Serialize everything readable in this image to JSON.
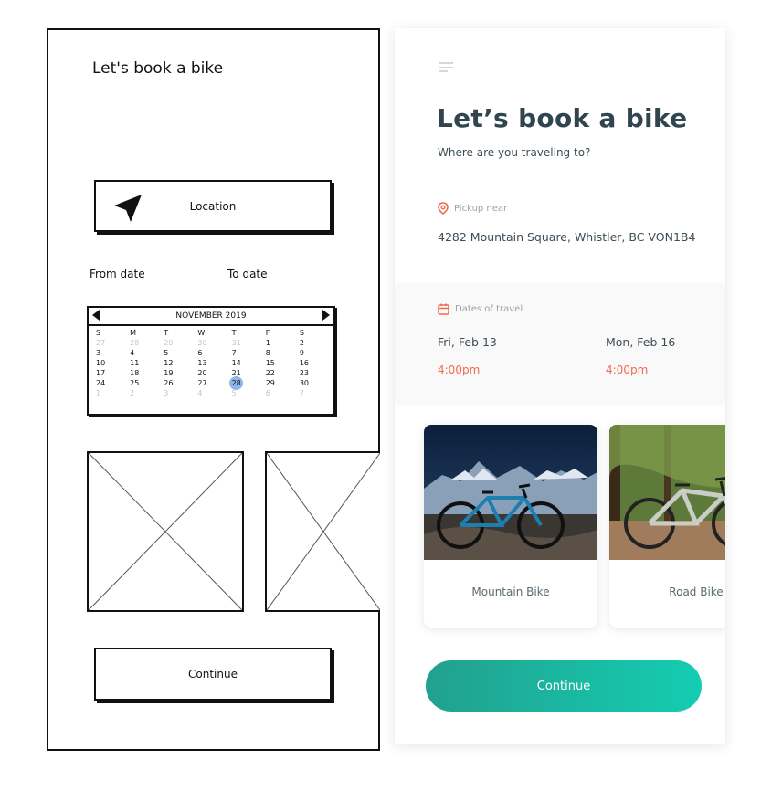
{
  "wireframe": {
    "title": "Let's book a bike",
    "location_label": "Location",
    "from_label": "From date",
    "to_label": "To date",
    "calendar": {
      "month": "NOVEMBER 2019",
      "weekdays": [
        "S",
        "M",
        "T",
        "W",
        "T",
        "F",
        "S"
      ],
      "weeks": [
        [
          "27",
          "28",
          "29",
          "30",
          "31",
          "1",
          "2"
        ],
        [
          "3",
          "4",
          "5",
          "6",
          "7",
          "8",
          "9"
        ],
        [
          "10",
          "11",
          "12",
          "13",
          "14",
          "15",
          "16"
        ],
        [
          "17",
          "18",
          "19",
          "20",
          "21",
          "22",
          "23"
        ],
        [
          "24",
          "25",
          "26",
          "27",
          "28",
          "29",
          "30"
        ],
        [
          "1",
          "2",
          "3",
          "4",
          "5",
          "6",
          "7"
        ]
      ],
      "selected": "28"
    },
    "continue_label": "Continue"
  },
  "app": {
    "title": "Let’s book a bike",
    "subtitle": "Where are you traveling to?",
    "pickup_label": "Pickup near",
    "address": "4282 Mountain Square, Whistler, BC VON1B4",
    "dates_label": "Dates of travel",
    "from_date": "Fri, Feb 13",
    "from_time": "4:00pm",
    "to_date": "Mon, Feb 16",
    "to_time": "4:00pm",
    "bikes": [
      {
        "name": "Mountain Bike"
      },
      {
        "name": "Road Bike"
      }
    ],
    "continue_label": "Continue",
    "colors": {
      "heading": "#30454f",
      "accent": "#f06a4d",
      "teal_start": "#22a08e",
      "teal_end": "#14cdb2"
    }
  }
}
